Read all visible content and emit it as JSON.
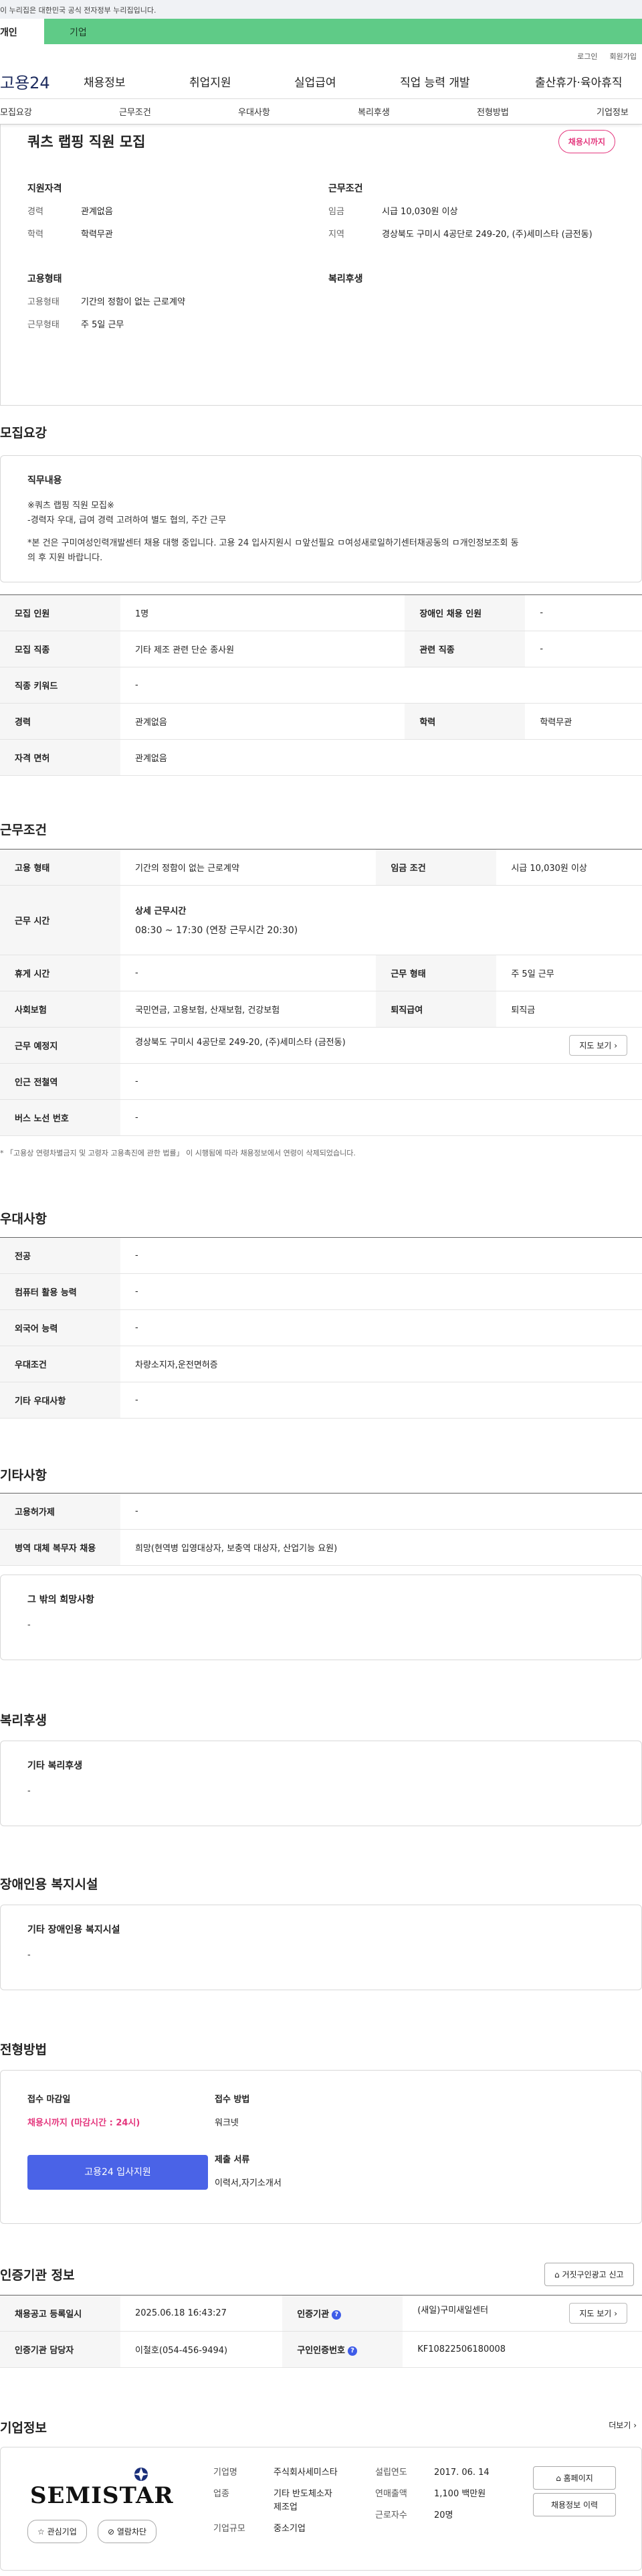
{
  "gov_banner": "이 누리집은 대한민국 공식 전자정부 누리집입니다.",
  "tabs": {
    "individual": "개인",
    "company": "기업"
  },
  "util_links": [
    "로그인",
    "회원가입"
  ],
  "gnb": {
    "logo": "고용24",
    "items": [
      "채용정보",
      "취업지원",
      "실업급여",
      "직업 능력 개발",
      "출산휴가·육아휴직"
    ]
  },
  "subnav": [
    "모집요강",
    "근무조건",
    "우대사항",
    "복리후생",
    "전형방법",
    "기업정보"
  ],
  "summary": {
    "title": "쿼츠 랩핑 직원 모집",
    "badge": "채용시까지",
    "qual": {
      "heading": "지원자격",
      "career_k": "경력",
      "career_v": "관계없음",
      "edu_k": "학력",
      "edu_v": "학력무관"
    },
    "cond": {
      "heading": "근무조건",
      "wage_k": "임금",
      "wage_v": "시급 10,030원 이상",
      "region_k": "지역",
      "region_v": "경상북도 구미시 4공단로 249-20, (주)세미스타 (금전동)"
    },
    "emp": {
      "heading": "고용형태",
      "type_k": "고용형태",
      "type_v": "기간의 정함이 없는 근로계약",
      "form_k": "근무형태",
      "form_v": "주 5일 근무"
    },
    "welfare": {
      "heading": "복리후생"
    }
  },
  "recruit": {
    "title": "모집요강",
    "duty_title": "직무내용",
    "duty_lines": [
      "※쿼츠 랩핑 직원 모집※",
      "-경력자 우대, 급여 경력 고려하여 별도 협의, 주간 근무",
      "",
      "*본 건은 구미여성인력개발센터 채용 대행 중입니다. 고용 24 입사지원시 ㅁ앞선필요 ㅁ여성새로일하기센터채공동의 ㅁ개인정보조회 동",
      "의 후 지원 바랍니다."
    ],
    "rows": [
      [
        "모집 인원",
        "1명",
        "장애인 채용 인원",
        "-"
      ],
      [
        "모집 직종",
        "기타 제조 관련 단순 종사원",
        "관련 직종",
        "-"
      ],
      [
        "직종 키워드",
        "-"
      ],
      [
        "경력",
        "관계없음",
        "학력",
        "학력무관"
      ],
      [
        "자격 면허",
        "관계없음"
      ]
    ]
  },
  "work": {
    "title": "근무조건",
    "type_k": "고용 형태",
    "type_v": "기간의 정함이 없는 근로계약",
    "wage_k": "임금 조건",
    "wage_v": "시급 10,030원 이상",
    "time_k": "근무 시간",
    "time_sub": "상세 근무시간",
    "time_v": "08:30 ~ 17:30 (연장 근무시간 20:30)",
    "rest_k": "휴게 시간",
    "rest_v": "-",
    "form_k": "근무 형태",
    "form_v": "주 5일 근무",
    "ins_k": "사회보험",
    "ins_v": "국민연금, 고용보험, 산재보험, 건강보험",
    "sev_k": "퇴직급여",
    "sev_v": "퇴직금",
    "place_k": "근무 예정지",
    "place_v": "경상북도 구미시 4공단로 249-20, (주)세미스타 (금전동)",
    "map_btn": "지도 보기",
    "sub_k": "인근 전철역",
    "sub_v": "-",
    "bus_k": "버스 노선 번호",
    "bus_v": "-",
    "note": "* 「고용상 연령차별금지 및 고령자 고용촉진에 관한 법률」 이 시행됨에 따라 채용정보에서 연령이 삭제되었습니다."
  },
  "pref": {
    "title": "우대사항",
    "rows": [
      [
        "전공",
        "-"
      ],
      [
        "컴퓨터 활용 능력",
        "-"
      ],
      [
        "외국어 능력",
        "-"
      ],
      [
        "우대조건",
        "차량소지자,운전면허증"
      ],
      [
        "기타 우대사항",
        "-"
      ]
    ]
  },
  "etc": {
    "title": "기타사항",
    "rows": [
      [
        "고용허가제",
        "-"
      ],
      [
        "병역 대체 복무자 채용",
        "희망(현역병 입영대상자, 보충역 대상자, 산업기능 요원)"
      ]
    ],
    "card_title": "그 밖의 희망사항",
    "card_value": "-"
  },
  "welfare": {
    "title": "복리후생",
    "card_title": "기타 복리후생",
    "card_value": "-"
  },
  "disabled": {
    "title": "장애인용 복지시설",
    "card_title": "기타 장애인용 복지시설",
    "card_value": "-"
  },
  "selection": {
    "title": "전형방법",
    "deadline_k": "접수 마감일",
    "deadline_v": "채용시까지 (마감시간 : 24시)",
    "apply_btn": "고용24 입사지원",
    "method_k": "접수 방법",
    "method_v": "워크넷",
    "docs_k": "제출 서류",
    "docs_v": "이력서,자기소개서"
  },
  "cert": {
    "title": "인증기관 정보",
    "report_btn": "거짓구인광고 신고",
    "reg_k": "채용공고 등록일시",
    "reg_v": "2025.06.18 16:43:27",
    "org_k": "인증기관",
    "org_v": "(새일)구미새일센터",
    "map_btn": "지도 보기",
    "mgr_k": "인증기관 담당자",
    "mgr_v": "이철호(054-456-9494)",
    "no_k": "구인인증번호",
    "no_v": "KF10822506180008"
  },
  "company": {
    "title": "기업정보",
    "more": "더보기",
    "logo_text": "SEMISTAR",
    "fav_btn": "관심기업",
    "block_btn": "열람차단",
    "name_k": "기업명",
    "name_v": "주식회사세미스타",
    "ind_k": "업종",
    "ind_v1": "기타 반도체소자",
    "ind_v2": "제조업",
    "scale_k": "기업규모",
    "scale_v": "중소기업",
    "est_k": "설립연도",
    "est_v": "2017. 06. 14",
    "sales_k": "연매출액",
    "sales_v": "1,100 백만원",
    "emp_k": "근로자수",
    "emp_v": "20명",
    "home_btn": "홈페이지",
    "list_btn": "채용정보 이력"
  },
  "colors": {
    "green": "#5fcb87",
    "pink": "#e4387e",
    "blue": "#4a63e7"
  }
}
